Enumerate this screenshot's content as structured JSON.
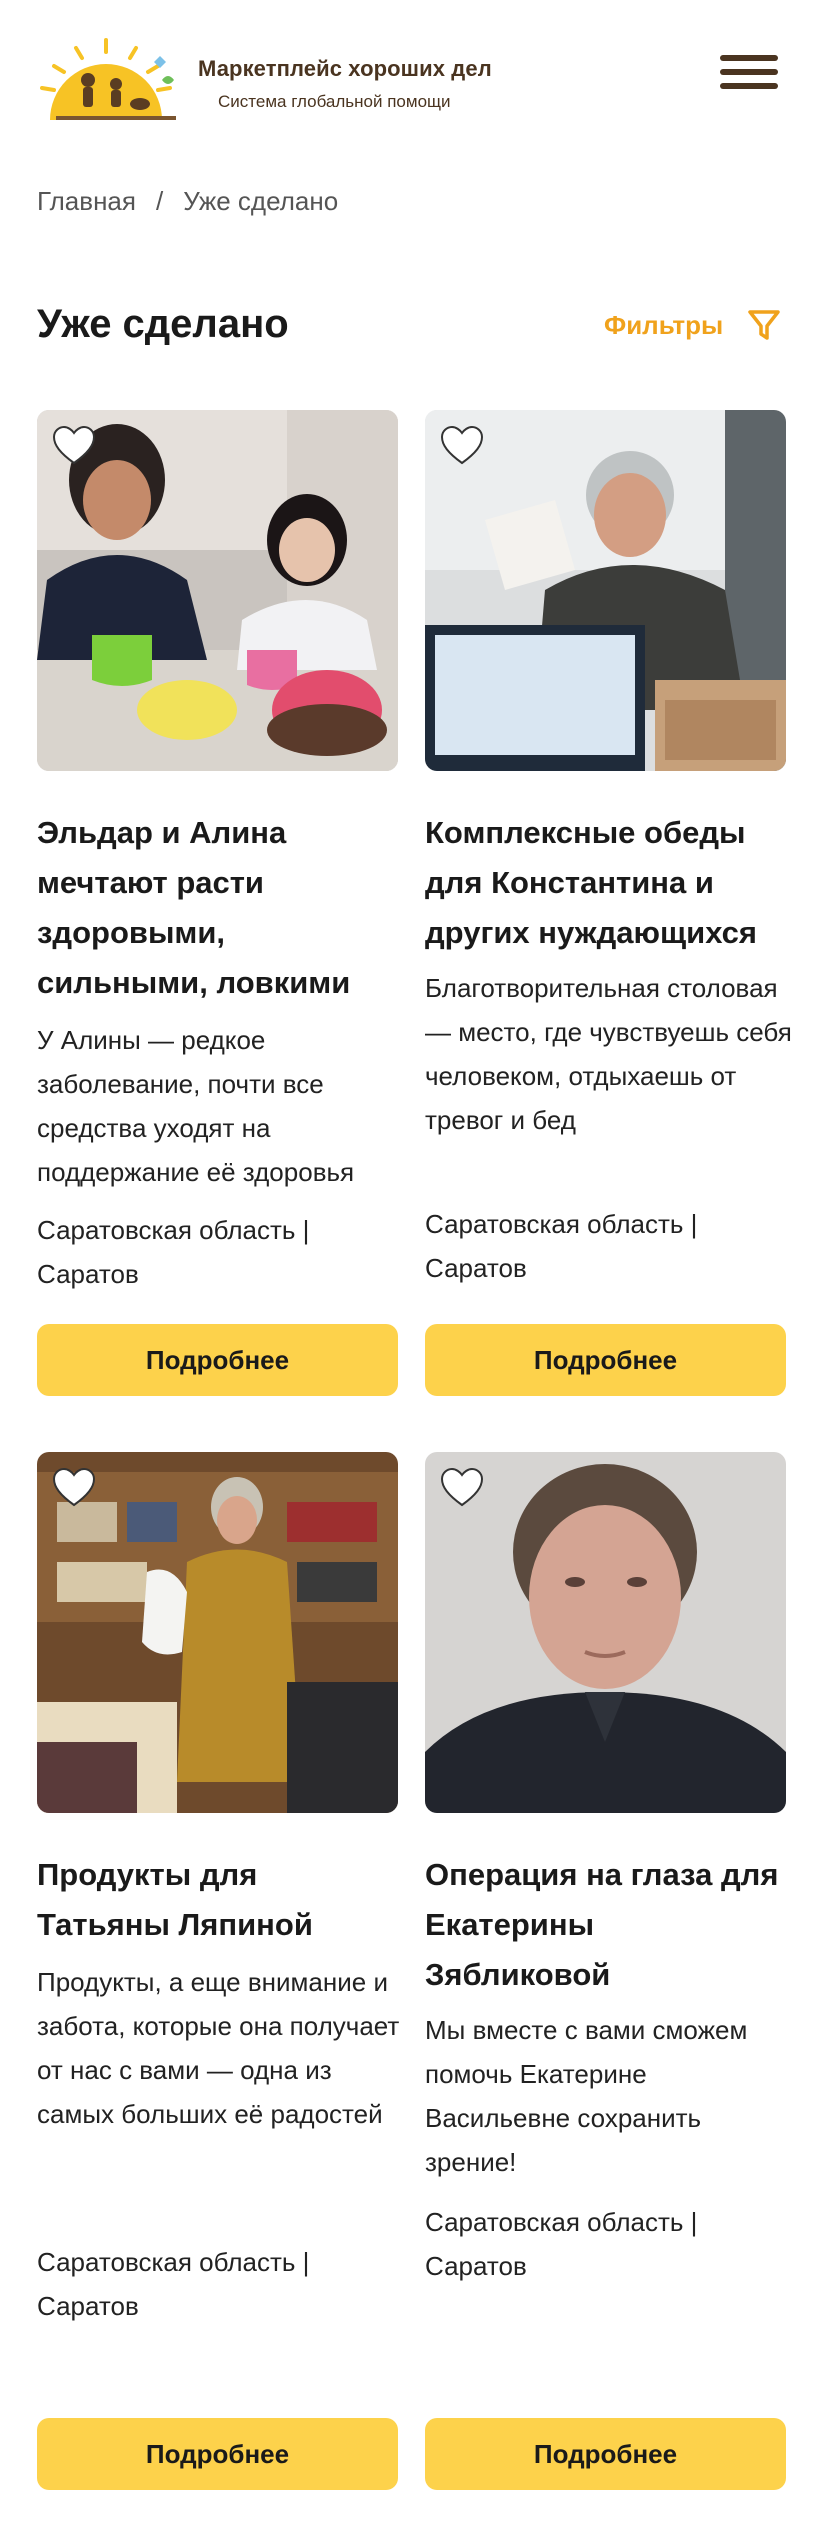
{
  "header": {
    "brand_title": "Маркетплейс хороших дел",
    "brand_subtitle": "Система глобальной помощи",
    "logo_icon": "sun-children-logo",
    "menu_icon": "hamburger-menu-icon"
  },
  "breadcrumb": {
    "home": "Главная",
    "separator": "/",
    "current": "Уже сделано"
  },
  "page": {
    "title": "Уже сделано",
    "filters_label": "Фильтры",
    "filter_icon": "funnel-icon"
  },
  "colors": {
    "accent": "#f0a21c",
    "button": "#fdd24b",
    "brand_text": "#4a3420"
  },
  "cards": [
    {
      "title": "Эльдар и Алина мечтают расти здоровыми, сильными, ловкими",
      "description": "У Алины — редкое заболевание, почти все средства уходят на поддержание её здоровья",
      "location": "Саратовская область | Саратов",
      "button": "Подробнее"
    },
    {
      "title": "Комплексные обеды для Константина и других нуждающихся",
      "description": "Благотворительная столовая — место, где чувствуешь себя человеком, отдыхаешь от тревог и бед",
      "location": "Саратовская область | Саратов",
      "button": "Подробнее"
    },
    {
      "title": "Продукты для Татьяны Ляпиной",
      "description": "Продукты, а еще внимание и забота, которые она получает от нас с вами — одна из самых больших её радостей",
      "location": "Саратовская область | Саратов",
      "button": "Подробнее"
    },
    {
      "title": "Операция на глаза для Екатерины Зябликовой",
      "description": "Мы вместе с вами сможем помочь Екатерине Васильевне сохранить зрение!",
      "location": "Саратовская область | Саратов",
      "button": "Подробнее"
    }
  ]
}
